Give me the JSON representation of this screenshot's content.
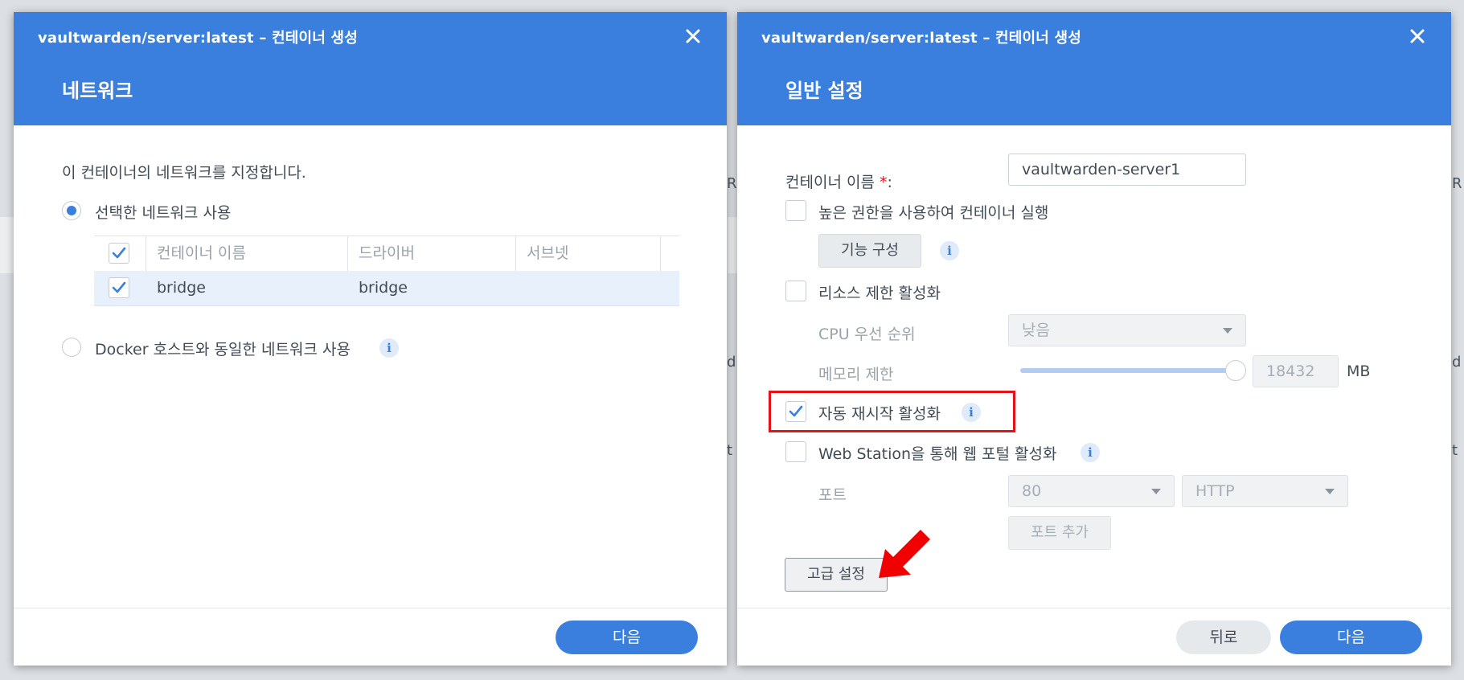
{
  "colors": {
    "accent": "#3a7fde",
    "header_text": "#ffffff",
    "highlight_box": "#e3131a",
    "annotation_arrow": "#f00000"
  },
  "background": {
    "peek_chars": [
      "R",
      "d",
      "t",
      "R",
      "d",
      "t"
    ]
  },
  "left_dialog": {
    "title": "vaultwarden/server:latest – 컨테이너 생성",
    "step_title": "네트워크",
    "close_icon": "close-icon",
    "description": "이 컨테이너의 네트워크를 지정합니다.",
    "radio_selected_network": {
      "label": "선택한 네트워크 사용",
      "selected": true
    },
    "network_table": {
      "columns": [
        "컨테이너 이름",
        "드라이버",
        "서브넷"
      ],
      "header_checked": true,
      "rows": [
        {
          "checked": true,
          "name": "bridge",
          "driver": "bridge",
          "subnet": ""
        }
      ]
    },
    "radio_host_network": {
      "label": "Docker 호스트와 동일한 네트워크 사용",
      "selected": false,
      "info_icon": "info-icon",
      "info_glyph": "i"
    },
    "footer": {
      "next_label": "다음"
    }
  },
  "right_dialog": {
    "title": "vaultwarden/server:latest – 컨테이너 생성",
    "step_title": "일반 설정",
    "close_icon": "close-icon",
    "container_name": {
      "label": "컨테이너 이름",
      "required_mark": "*",
      "colon": ":",
      "value": "vaultwarden-server1"
    },
    "privileged": {
      "label": "높은 권한을 사용하여 컨테이너 실행",
      "checked": false
    },
    "capabilities_button": {
      "label": "기능 구성",
      "info_glyph": "i"
    },
    "resource_limit": {
      "label": "리소스 제한 활성화",
      "checked": false
    },
    "cpu_priority": {
      "label": "CPU 우선 순위",
      "value": "낮음"
    },
    "memory_limit": {
      "label": "메모리 제한",
      "value": "18432",
      "unit": "MB",
      "slider_fraction": 1.0
    },
    "auto_restart": {
      "label": "자동 재시작 활성화",
      "checked": true,
      "info_glyph": "i",
      "highlighted": true
    },
    "web_station": {
      "label": "Web Station을 통해 웹 포털 활성화",
      "checked": false,
      "info_glyph": "i"
    },
    "port": {
      "label": "포트",
      "port_value": "80",
      "protocol_value": "HTTP",
      "add_label": "포트 추가"
    },
    "advanced_button": {
      "label": "고급 설정"
    },
    "footer": {
      "back_label": "뒤로",
      "next_label": "다음"
    }
  }
}
